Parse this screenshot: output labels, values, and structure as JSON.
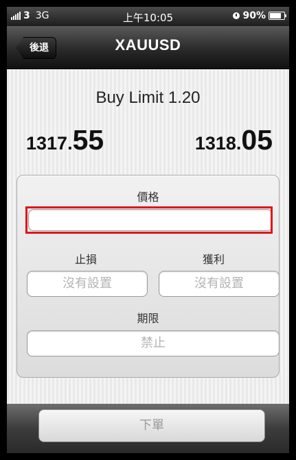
{
  "status": {
    "carrier": "3",
    "network": "3G",
    "time": "上午10:05",
    "battery": "90%",
    "battery_fraction": 0.9
  },
  "nav": {
    "back_label": "後退",
    "title": "XAUUSD"
  },
  "order": {
    "type_label": "Buy Limit 1.20",
    "bid_small": "1317.",
    "bid_big": "55",
    "ask_small": "1318.",
    "ask_big": "05"
  },
  "form": {
    "price_label": "價格",
    "price_value": "",
    "stop_loss_label": "止損",
    "stop_loss_value": "沒有設置",
    "take_profit_label": "獲利",
    "take_profit_value": "沒有設置",
    "expiry_label": "期限",
    "expiry_value": "禁止"
  },
  "toolbar": {
    "order_button_label": "下單"
  },
  "colors": {
    "highlight": "#e2141b"
  }
}
